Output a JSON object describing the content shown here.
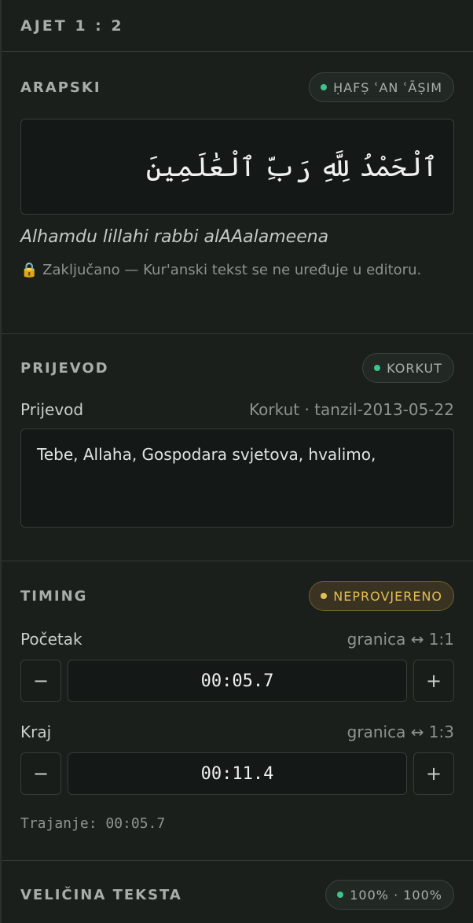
{
  "header": {
    "title": "AJET 1 : 2"
  },
  "arabic_section": {
    "title": "ARAPSKI",
    "badge": "ḤAFṢ ʿAN ʿĀṢIM",
    "badge_color": "#3ec48a",
    "verse": "ٱلْحَمْدُ لِلَّهِ رَبِّ ٱلْعَٰلَمِينَ",
    "transliteration": "Alhamdu lillahi rabbi alAAalameena",
    "lock_icon": "🔒",
    "lock_note": "Zaključano — Kur'anski tekst se ne uređuje u editoru."
  },
  "translation_section": {
    "title": "PRIJEVOD",
    "badge": "KORKUT",
    "badge_color": "#3ec48a",
    "field_label": "Prijevod",
    "field_meta": "Korkut · tanzil-2013-05-22",
    "value": "Tebe, Allaha, Gospodara svjetova, hvalimo,"
  },
  "timing_section": {
    "title": "TIMING",
    "badge": "NEPROVJERENO",
    "badge_color": "#e4be54",
    "start": {
      "label": "Početak",
      "meta": "granica ↔ 1:1",
      "value": "00:05.7",
      "minus": "−",
      "plus": "+"
    },
    "end": {
      "label": "Kraj",
      "meta": "granica ↔ 1:3",
      "value": "00:11.4",
      "minus": "−",
      "plus": "+"
    },
    "duration": "Trajanje: 00:05.7"
  },
  "text_size_section": {
    "title": "VELIČINA TEKSTA",
    "badge": "100% · 100%",
    "badge_color": "#3ec48a"
  }
}
